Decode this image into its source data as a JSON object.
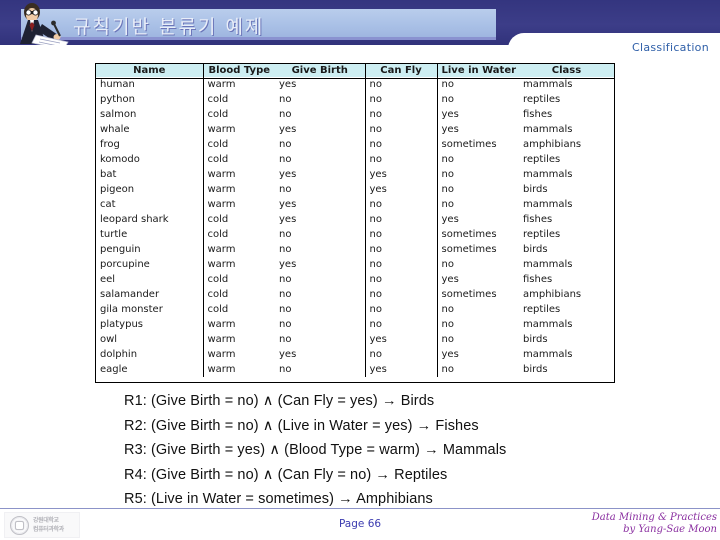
{
  "slide": {
    "title": "규칙기반 분류기 예제",
    "section_label": "Classification",
    "icons": {
      "presenter": "presenter-clipart-icon",
      "university_seal": "university-seal-icon"
    },
    "colors": {
      "background": "#2e2f7a",
      "title_bar": "#b9cdec",
      "table_header": "#cdeef2",
      "section_label": "#2f5fa8",
      "page_number": "#3b3bb0",
      "credit": "#8a2fa0"
    }
  },
  "table": {
    "columns": [
      "Name",
      "Blood Type",
      "Give Birth",
      "Can Fly",
      "Live in Water",
      "Class"
    ],
    "rows": [
      [
        "human",
        "warm",
        "yes",
        "no",
        "no",
        "mammals"
      ],
      [
        "python",
        "cold",
        "no",
        "no",
        "no",
        "reptiles"
      ],
      [
        "salmon",
        "cold",
        "no",
        "no",
        "yes",
        "fishes"
      ],
      [
        "whale",
        "warm",
        "yes",
        "no",
        "yes",
        "mammals"
      ],
      [
        "frog",
        "cold",
        "no",
        "no",
        "sometimes",
        "amphibians"
      ],
      [
        "komodo",
        "cold",
        "no",
        "no",
        "no",
        "reptiles"
      ],
      [
        "bat",
        "warm",
        "yes",
        "yes",
        "no",
        "mammals"
      ],
      [
        "pigeon",
        "warm",
        "no",
        "yes",
        "no",
        "birds"
      ],
      [
        "cat",
        "warm",
        "yes",
        "no",
        "no",
        "mammals"
      ],
      [
        "leopard shark",
        "cold",
        "yes",
        "no",
        "yes",
        "fishes"
      ],
      [
        "turtle",
        "cold",
        "no",
        "no",
        "sometimes",
        "reptiles"
      ],
      [
        "penguin",
        "warm",
        "no",
        "no",
        "sometimes",
        "birds"
      ],
      [
        "porcupine",
        "warm",
        "yes",
        "no",
        "no",
        "mammals"
      ],
      [
        "eel",
        "cold",
        "no",
        "no",
        "yes",
        "fishes"
      ],
      [
        "salamander",
        "cold",
        "no",
        "no",
        "sometimes",
        "amphibians"
      ],
      [
        "gila monster",
        "cold",
        "no",
        "no",
        "no",
        "reptiles"
      ],
      [
        "platypus",
        "warm",
        "no",
        "no",
        "no",
        "mammals"
      ],
      [
        "owl",
        "warm",
        "no",
        "yes",
        "no",
        "birds"
      ],
      [
        "dolphin",
        "warm",
        "yes",
        "no",
        "yes",
        "mammals"
      ],
      [
        "eagle",
        "warm",
        "no",
        "yes",
        "no",
        "birds"
      ]
    ]
  },
  "rules": [
    "R1: (Give Birth = no) ∧ (Can Fly = yes) → Birds",
    "R2: (Give Birth = no) ∧ (Live in Water = yes) → Fishes",
    "R3: (Give Birth = yes) ∧ (Blood Type = warm) → Mammals",
    "R4: (Give Birth = no) ∧ (Can Fly = no) → Reptiles",
    "R5: (Live in Water = sometimes) → Amphibians"
  ],
  "footer": {
    "page": "Page 66",
    "credit_line1": "Data Mining & Practices",
    "credit_line2": "by Yang-Sae Moon",
    "logo_line1": "강원대학교",
    "logo_line2": "컴퓨터과학과"
  }
}
